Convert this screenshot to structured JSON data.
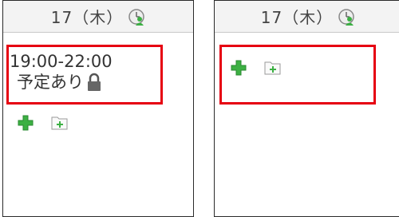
{
  "days": [
    {
      "id": "left",
      "header": {
        "date": "17（木）"
      },
      "event": {
        "time": "19:00-22:00",
        "label": "予定あり"
      },
      "icons": {
        "people": "people-clock-icon",
        "lock": "lock-icon",
        "add": "green-plus-icon",
        "folder_add": "folder-plus-icon"
      }
    },
    {
      "id": "right",
      "header": {
        "date": "17（木）"
      },
      "icons": {
        "people": "people-clock-icon",
        "add": "green-plus-icon",
        "folder_add": "folder-plus-icon"
      }
    }
  ],
  "colors": {
    "highlight": "#e60012",
    "accent_green": "#3cb043",
    "header_bg": "#f3f3f3",
    "border": "#2a2a2a"
  }
}
